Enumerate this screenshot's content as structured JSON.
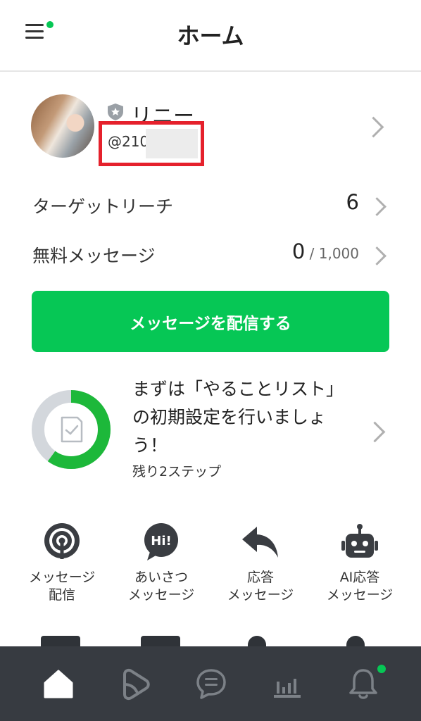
{
  "header": {
    "title": "ホーム",
    "menu_icon": "hamburger-menu-icon",
    "accent_color": "#06c755"
  },
  "profile": {
    "name": "リニー",
    "id_prefix": "@210",
    "badge_icon": "star-shield-icon",
    "highlight_color": "#e5212c"
  },
  "stats": {
    "target_reach": {
      "label": "ターゲットリーチ",
      "value": "6"
    },
    "free_messages": {
      "label": "無料メッセージ",
      "value": "0",
      "total": " / 1,000"
    }
  },
  "send_button": {
    "label": "メッセージを配信する"
  },
  "todo": {
    "text": "まずは「やることリスト」の初期設定を行いましょう！",
    "sub": "残り2ステップ",
    "progress_fraction": 0.6
  },
  "quick_actions": [
    {
      "label": "メッセージ\n配信",
      "icon": "broadcast-icon"
    },
    {
      "label": "あいさつ\nメッセージ",
      "icon": "hi-bubble-icon"
    },
    {
      "label": "応答\nメッセージ",
      "icon": "reply-arrow-icon"
    },
    {
      "label": "AI応答\nメッセージ",
      "icon": "robot-icon"
    }
  ],
  "tabbar": {
    "items": [
      {
        "icon": "home-icon",
        "active": true
      },
      {
        "icon": "voom-icon",
        "active": false
      },
      {
        "icon": "chat-icon",
        "active": false
      },
      {
        "icon": "analytics-icon",
        "active": false
      },
      {
        "icon": "bell-icon",
        "active": false
      }
    ]
  }
}
